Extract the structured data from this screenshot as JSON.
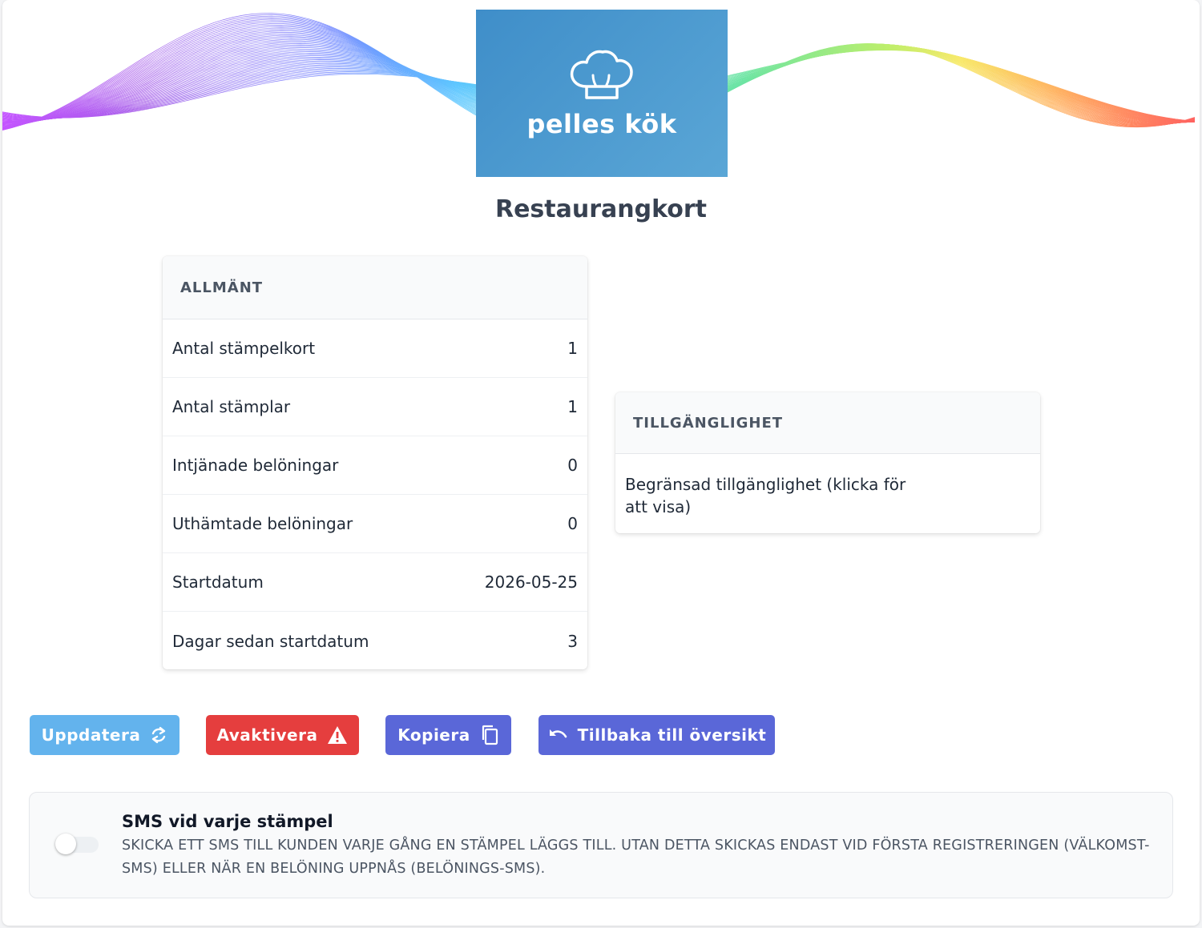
{
  "header": {
    "logo_text": "pelles kök",
    "page_title": "Restaurangkort"
  },
  "general": {
    "title": "ALLMÄNT",
    "rows": [
      {
        "label": "Antal stämpelkort",
        "value": "1"
      },
      {
        "label": "Antal stämplar",
        "value": "1"
      },
      {
        "label": "Intjänade belöningar",
        "value": "0"
      },
      {
        "label": "Uthämtade belöningar",
        "value": "0"
      },
      {
        "label": "Startdatum",
        "value": "2026-05-25"
      },
      {
        "label": "Dagar sedan startdatum",
        "value": "3"
      }
    ]
  },
  "availability": {
    "title": "TILLGÄNGLIGHET",
    "text": "Begränsad tillgänglighet (klicka för att visa)"
  },
  "actions": {
    "update": "Uppdatera",
    "deactivate": "Avaktivera",
    "copy": "Kopiera",
    "back": "Tillbaka till översikt"
  },
  "sms": {
    "title": "SMS vid varje stämpel",
    "description": "Skicka ett SMS till kunden varje gång en stämpel läggs till. Utan detta skickas endast vid första registreringen (välkomst-SMS) eller när en belöning uppnås (belönings-SMS).",
    "enabled": false
  },
  "colors": {
    "update_button": "#63b3ed",
    "deactivate_button": "#e53e3e",
    "primary_button": "#5a67d8",
    "logo_background": "#4a9ad0"
  }
}
